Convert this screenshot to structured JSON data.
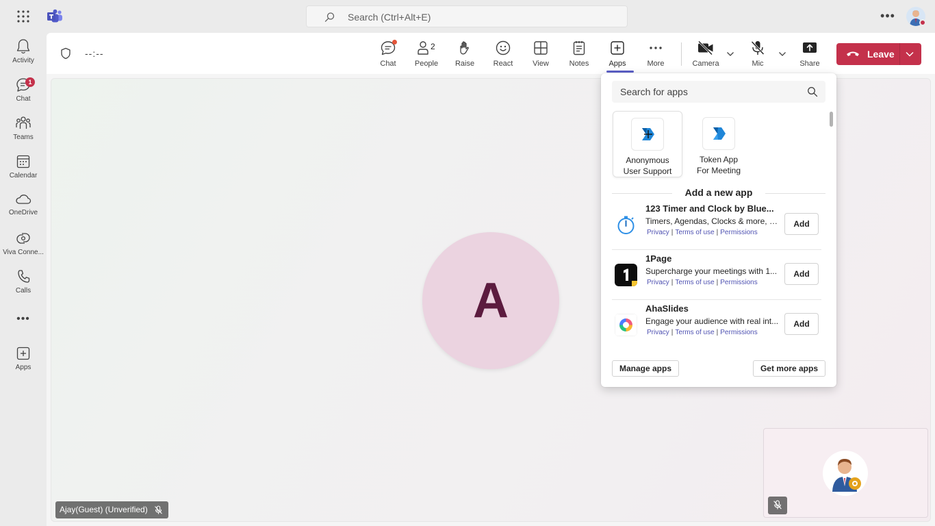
{
  "titlebar": {
    "search_placeholder": "Search (Ctrl+Alt+E)"
  },
  "rail": {
    "items": [
      {
        "label": "Activity",
        "icon": "bell-icon"
      },
      {
        "label": "Chat",
        "icon": "chat-icon",
        "badge": "1"
      },
      {
        "label": "Teams",
        "icon": "teams-icon"
      },
      {
        "label": "Calendar",
        "icon": "calendar-icon"
      },
      {
        "label": "OneDrive",
        "icon": "cloud-icon"
      },
      {
        "label": "Viva Conne...",
        "icon": "viva-connections-icon"
      },
      {
        "label": "Calls",
        "icon": "phone-icon"
      },
      {
        "label": "Apps",
        "icon": "plus-square-icon"
      }
    ],
    "more": "•••"
  },
  "meeting": {
    "timer": "--:--",
    "toolbar": {
      "chat": "Chat",
      "people": "People",
      "people_count": "2",
      "raise": "Raise",
      "react": "React",
      "view": "View",
      "notes": "Notes",
      "apps": "Apps",
      "more": "More",
      "camera": "Camera",
      "mic": "Mic",
      "share": "Share",
      "leave": "Leave"
    },
    "participant_initial": "A",
    "participant_name": "Ajay(Guest) (Unverified)"
  },
  "apps_flyout": {
    "search_placeholder": "Search for apps",
    "pinned": [
      {
        "label_line1": "Anonymous",
        "label_line2": "User Support"
      },
      {
        "label_line1": "Token App",
        "label_line2": "For Meeting"
      }
    ],
    "section_title": "Add a new app",
    "apps": [
      {
        "name": "123 Timer and Clock by Blue...",
        "desc": "Timers, Agendas, Clocks & more, e...",
        "privacy": "Privacy",
        "terms": "Terms of use",
        "permissions": "Permissions",
        "add": "Add"
      },
      {
        "name": "1Page",
        "desc": "Supercharge your meetings with 1...",
        "privacy": "Privacy",
        "terms": "Terms of use",
        "permissions": "Permissions",
        "add": "Add"
      },
      {
        "name": "AhaSlides",
        "desc": "Engage your audience with real int...",
        "privacy": "Privacy",
        "terms": "Terms of use",
        "permissions": "Permissions",
        "add": "Add"
      }
    ],
    "manage_apps": "Manage apps",
    "get_more_apps": "Get more apps"
  },
  "colors": {
    "accent": "#5b5fc7",
    "leave": "#c4314b",
    "badge": "#c4314b",
    "avatar_bg": "#ebd3e0",
    "avatar_text": "#5c1b3f"
  }
}
